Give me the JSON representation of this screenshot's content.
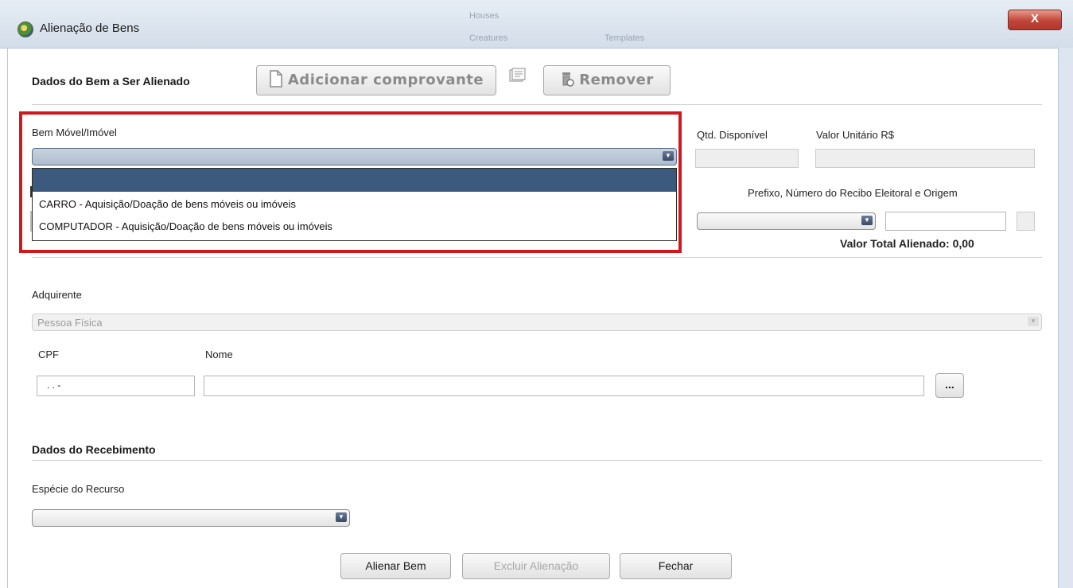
{
  "window": {
    "title": "Alienação de Bens",
    "close_label": "X",
    "ghost_text": [
      "Houses",
      "Creatures",
      "Templates"
    ]
  },
  "section_bem": {
    "title": "Dados do Bem a Ser Alienado",
    "add_button_label": "Adicionar comprovante",
    "remove_button_label": "Remover"
  },
  "bem": {
    "label": "Bem Móvel/Imóvel",
    "dropdown_options": [
      "",
      "CARRO - Aquisição/Doação de bens móveis ou imóveis",
      "COMPUTADOR - Aquisição/Doação de bens móveis ou imóveis"
    ],
    "qtd_label": "Qtd. Disponível",
    "valor_label": "Valor Unitário R$",
    "prefixo_label": "Prefixo, Número do Recibo Eleitoral e Origem",
    "total_label": "Valor Total Alienado:",
    "total_value": "0,00"
  },
  "adquirente": {
    "label": "Adquirente",
    "select_value": "Pessoa Física",
    "cpf_label": "CPF",
    "cpf_value": ". . -",
    "nome_label": "Nome",
    "browse_label": "..."
  },
  "recebimento": {
    "title": "Dados do Recebimento",
    "especie_label": "Espécie do Recurso"
  },
  "footer": {
    "alienar_label": "Alienar Bem",
    "excluir_label": "Excluir Alienação",
    "fechar_label": "Fechar"
  }
}
